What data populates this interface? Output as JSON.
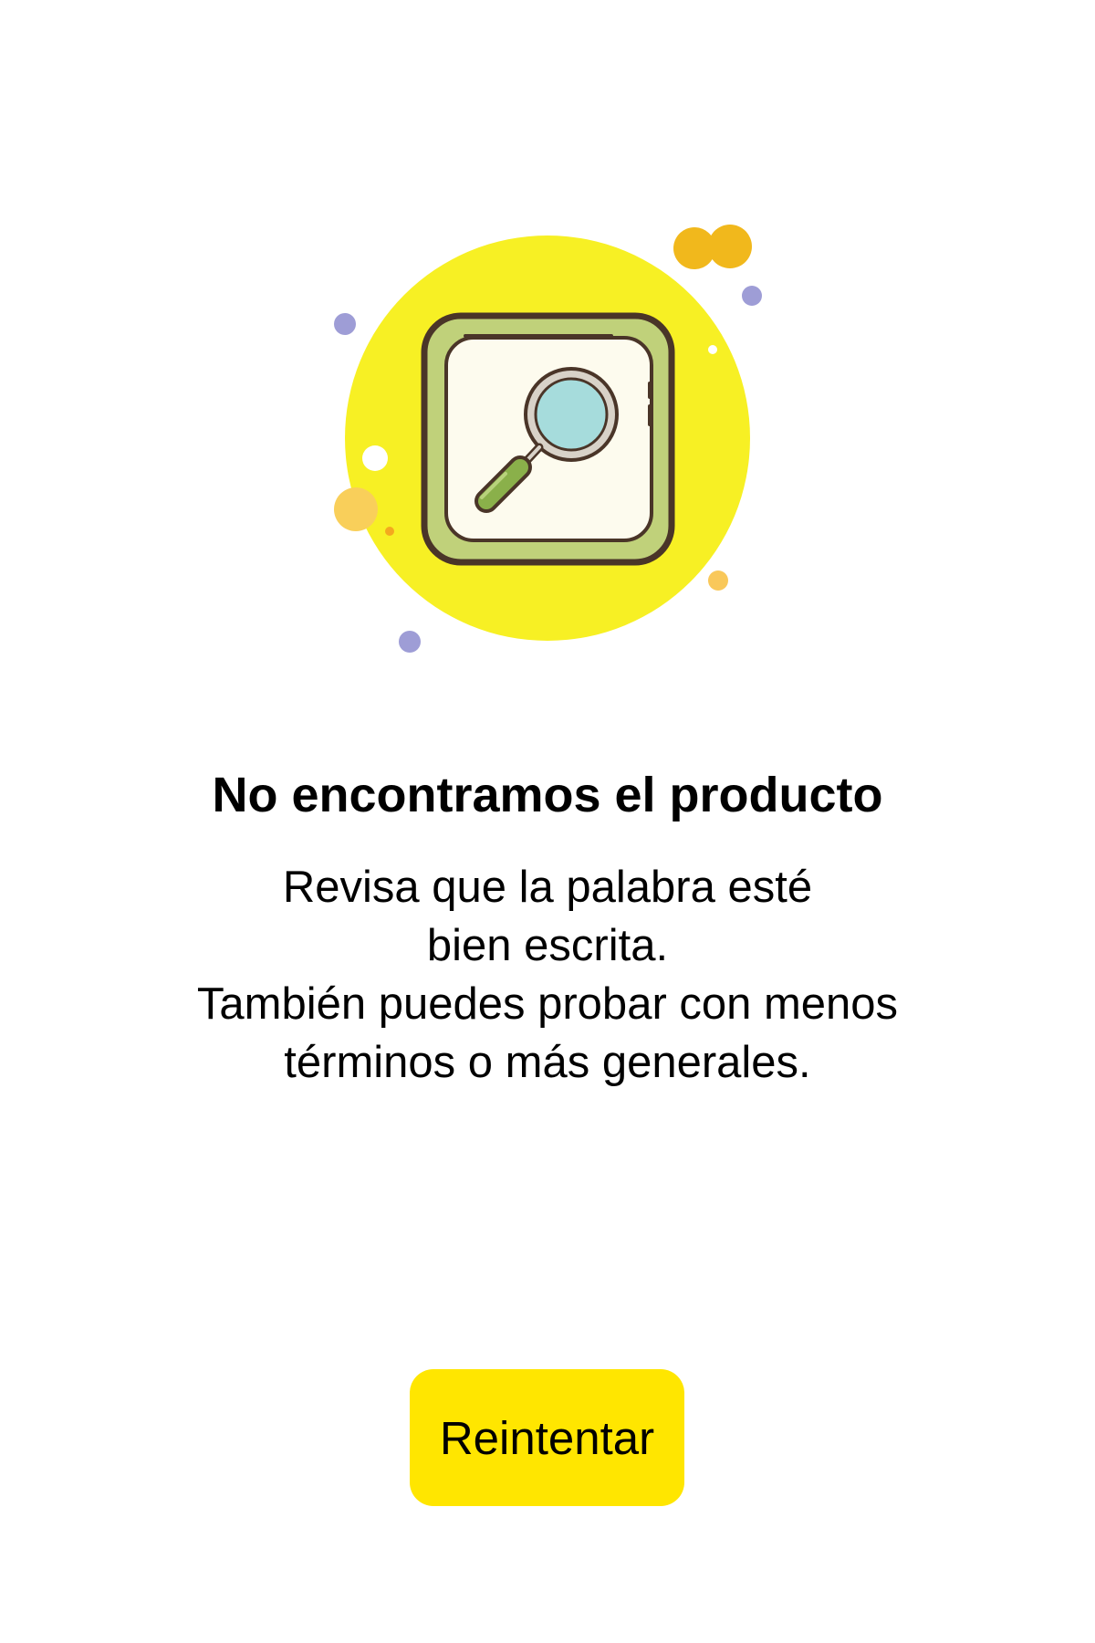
{
  "illustration": {
    "icon": "magnifier-search-icon",
    "colors": {
      "circle": "#f7f024",
      "frame": "#c0d17a",
      "frame_outline": "#4a3528",
      "inner": "#fdfbee",
      "lens": "#a6dcdc",
      "handle": "#8ab04a",
      "dot_orange": "#f4b922",
      "dot_purple": "#9e9dd6"
    }
  },
  "empty_state": {
    "title": "No encontramos el producto",
    "message_lines": [
      "Revisa que la palabra esté",
      "bien escrita.",
      "También puedes probar con menos",
      "términos o más generales."
    ]
  },
  "actions": {
    "retry_label": "Reintentar",
    "retry_color": "#ffe600"
  }
}
